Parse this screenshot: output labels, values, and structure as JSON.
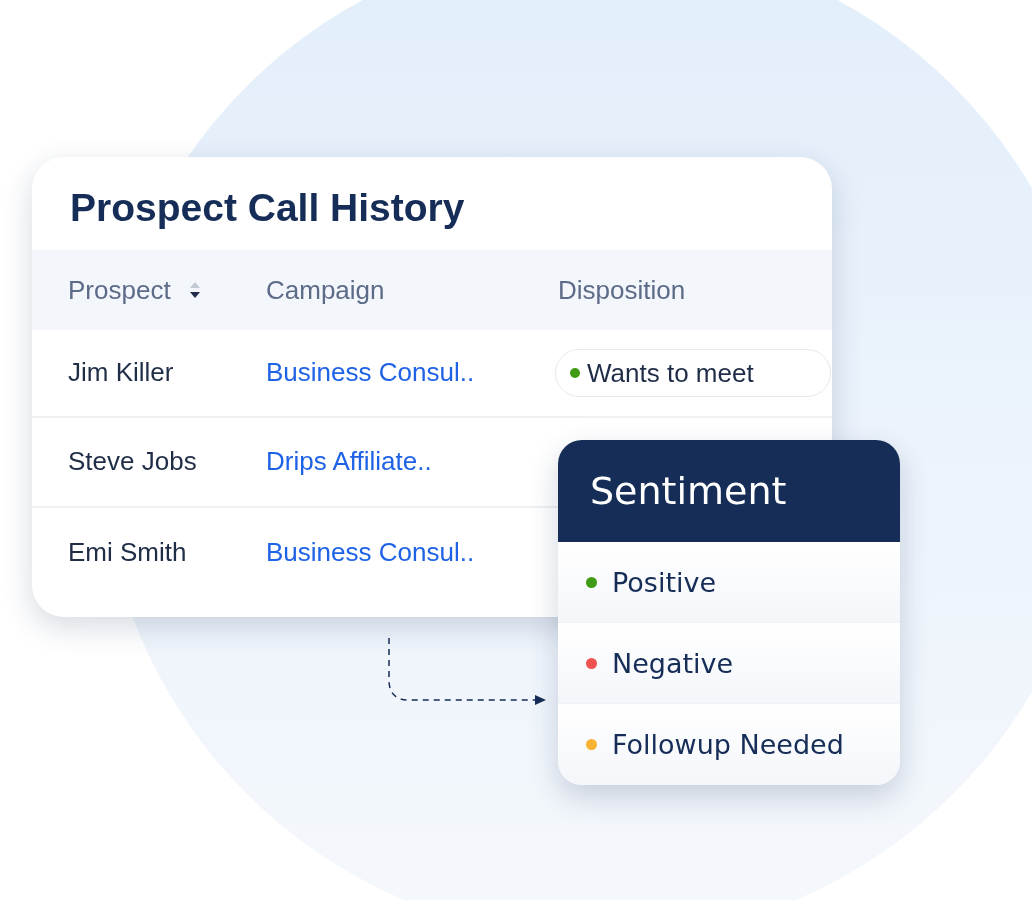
{
  "call_history": {
    "title": "Prospect Call History",
    "columns": [
      {
        "label": "Prospect",
        "sort_descending": true
      },
      {
        "label": "Campaign"
      },
      {
        "label": "Disposition"
      }
    ],
    "rows": [
      {
        "prospect": "Jim Killer",
        "campaign": "Business Consul..",
        "disposition": {
          "label": "Wants to meet",
          "color": "#3f9b14"
        }
      },
      {
        "prospect": "Steve Jobs",
        "campaign": "Drips Affiliate.."
      },
      {
        "prospect": "Emi Smith",
        "campaign": "Business Consul.."
      }
    ]
  },
  "sentiment_popup": {
    "title": "Sentiment",
    "options": [
      {
        "label": "Positive",
        "color": "#3f9b14"
      },
      {
        "label": "Negative",
        "color": "#ef5350"
      },
      {
        "label": "Followup Needed",
        "color": "#f9b233"
      }
    ]
  }
}
